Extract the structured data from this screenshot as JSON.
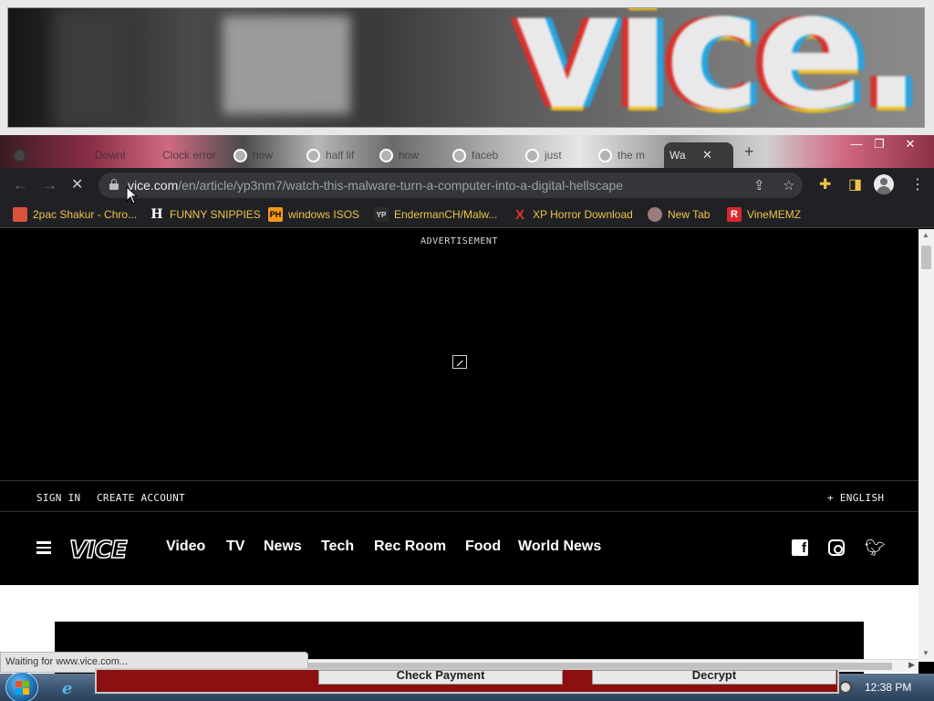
{
  "banner": {
    "glitch_text": "vice."
  },
  "tabs": [
    {
      "title": ""
    },
    {
      "title": "Downl"
    },
    {
      "title": "Clock error"
    },
    {
      "title": "how"
    },
    {
      "title": "half lif"
    },
    {
      "title": "how"
    },
    {
      "title": "faceb"
    },
    {
      "title": "just"
    },
    {
      "title": "the m"
    },
    {
      "title": "Wa",
      "active": true
    }
  ],
  "window_controls": {
    "minimize": "—",
    "maximize": "❐",
    "close": "✕"
  },
  "toolbar": {
    "url_host": "vice.com",
    "url_path": "/en/article/yp3nm7/watch-this-malware-turn-a-computer-into-a-digital-hellscape"
  },
  "bookmarks": [
    {
      "label": "2pac Shakur - Chro...",
      "icon": "bookmark-favicon",
      "fav": "",
      "fav_color": "#d9533a"
    },
    {
      "label": "FUNNY SNIPPIES",
      "icon": "h-favicon",
      "fav": "H",
      "fav_color": "#ffffff"
    },
    {
      "label": "windows ISOS",
      "icon": "ph-favicon",
      "fav": "PH",
      "fav_color": "#f7971d"
    },
    {
      "label": "EndermanCH/Malw...",
      "icon": "yp-favicon",
      "fav": "YP",
      "fav_color": "#6b6b6b"
    },
    {
      "label": "XP Horror Download",
      "icon": "x-favicon",
      "fav": "X",
      "fav_color": "#e23333"
    },
    {
      "label": "New Tab",
      "icon": "globe-favicon",
      "fav": "",
      "fav_color": "#9a7c7c"
    },
    {
      "label": "VineMEMZ",
      "icon": "r-favicon",
      "fav": "R",
      "fav_color": "#d8292f"
    }
  ],
  "page": {
    "ad_label": "ADVERTISEMENT",
    "sign_in": "SIGN IN",
    "create_account": "CREATE ACCOUNT",
    "language": "+ ENGLISH",
    "logo": "VICE",
    "nav": [
      "Video",
      "TV",
      "News",
      "Tech",
      "Rec Room",
      "Food",
      "World News"
    ]
  },
  "status": "Waiting for www.vice.com...",
  "ransom_window": {
    "check_payment": "Check Payment",
    "decrypt": "Decrypt"
  },
  "taskbar": {
    "clock": "12:38 PM"
  },
  "colors": {
    "bookmark_text": "#f0c24a",
    "ransom_red": "#8c1010",
    "chrome_dark": "#202124"
  }
}
